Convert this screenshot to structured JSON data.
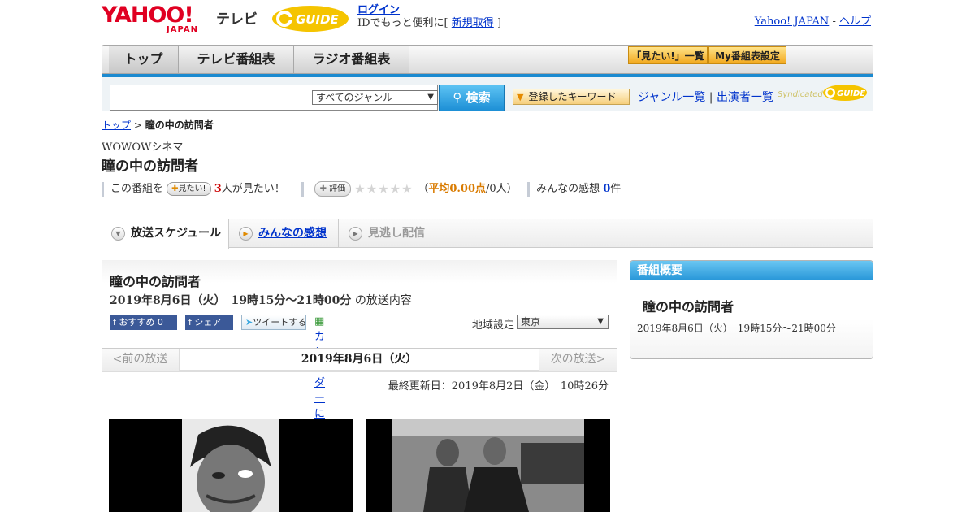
{
  "header": {
    "yahoo_word": "YAHOO!",
    "yahoo_japan": "JAPAN",
    "tv_label": "テレビ",
    "gguide_logo": "GUIDE",
    "login": "ログイン",
    "login_sub_prefix": "IDでもっと便利に[",
    "signup": "新規取得",
    "login_sub_suffix": "]",
    "yahoo_japan_link": "Yahoo! JAPAN",
    "sep": " - ",
    "help_link": "ヘルプ"
  },
  "nav": {
    "tabs": [
      "トップ",
      "テレビ番組表",
      "ラジオ番組表"
    ],
    "mitai_list": "「見たい!」一覧",
    "my_schedule": "My番組表設定"
  },
  "search": {
    "genre_value": "すべてのジャンル",
    "button": "検索",
    "keyword_button": "登録したキーワード",
    "genre_list": "ジャンル一覧",
    "link_sep": " | ",
    "cast_list": "出演者一覧",
    "syndicated": "Syndicated"
  },
  "breadcrumb": {
    "top": "トップ",
    "sep": " > ",
    "current": "瞳の中の訪問者"
  },
  "program": {
    "channel": "WOWOWシネマ",
    "title": "瞳の中の訪問者",
    "stats": {
      "prefix": "この番組を",
      "mitai_btn": "見たい!",
      "count": "3",
      "suffix": "人が見たい！",
      "rate_btn": "評価",
      "avg_open": "（",
      "avg": "平均0.00点",
      "avg_people": "/0人）",
      "impressions_label": "みんなの感想",
      "impressions_count": "0",
      "impressions_unit": "件",
      "rating_stars": 0
    }
  },
  "tabs": [
    "放送スケジュール",
    "みんなの感想",
    "見逃し配信"
  ],
  "schedule": {
    "title": "瞳の中の訪問者",
    "date_time": "2019年8月6日（火）　19時15分～21時00分",
    "date_suffix": "の放送内容",
    "fb_recommend": "おすすめ",
    "fb_count": "0",
    "fb_share": "シェア",
    "tweet": "ツイートする",
    "calendar": "カレンダーに登録",
    "region_label": "地域設定",
    "region_value": "東京",
    "prev": "<前の放送",
    "pager_date": "2019年8月6日（火）",
    "next": "次の放送>",
    "updated": "最終更新日：2019年8月2日（金）　10時26分"
  },
  "overview": {
    "header": "番組概要",
    "title": "瞳の中の訪問者",
    "date": "2019年8月6日（火）　19時15分～21時00分"
  },
  "colors": {
    "accent_blue": "#1b8ad0",
    "link": "#0033cc",
    "yahoo_red": "#e00022",
    "gguide_yellow": "#f5c400"
  }
}
